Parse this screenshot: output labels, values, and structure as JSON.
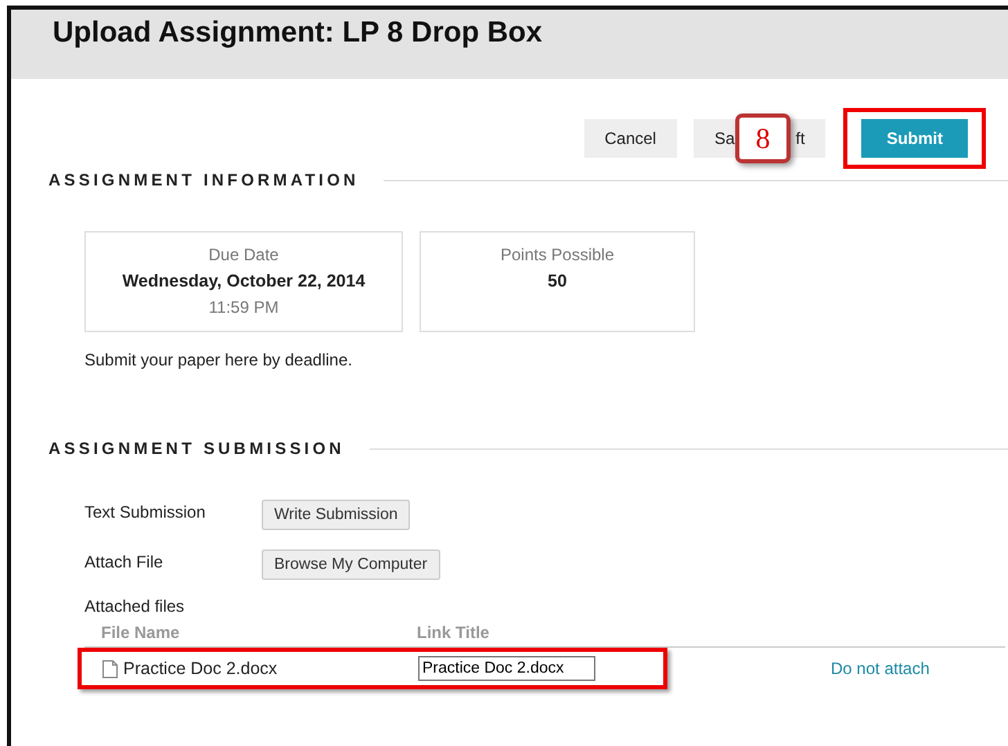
{
  "title": "Upload Assignment: LP 8 Drop Box",
  "buttons": [
    {
      "label": "Cancel",
      "kind": "plain",
      "highlighted": false
    },
    {
      "visible_parts": [
        "Sa",
        "ft"
      ],
      "kind": "plain",
      "highlighted": false
    },
    {
      "label": "Submit",
      "kind": "primary",
      "highlighted": true
    }
  ],
  "callout": "8",
  "assignment_information": {
    "heading": "ASSIGNMENT INFORMATION",
    "cards": [
      {
        "label": "Due Date",
        "value": "Wednesday, October 22, 2014",
        "sub": "11:59 PM"
      },
      {
        "label": "Points Possible",
        "value": "50"
      }
    ],
    "instructions": "Submit your paper here by deadline."
  },
  "assignment_submission": {
    "heading": "ASSIGNMENT SUBMISSION",
    "fields": [
      {
        "label": "Text Submission",
        "button": "Write Submission"
      },
      {
        "label": "Attach File",
        "button": "Browse My Computer"
      }
    ],
    "attached_files": {
      "label": "Attached files",
      "columns": [
        "File Name",
        "Link Title"
      ],
      "rows": [
        {
          "file_name": "Practice Doc 2.docx",
          "link_title": "Practice Doc 2.docx",
          "action": "Do not attach",
          "highlighted": true
        }
      ]
    }
  }
}
